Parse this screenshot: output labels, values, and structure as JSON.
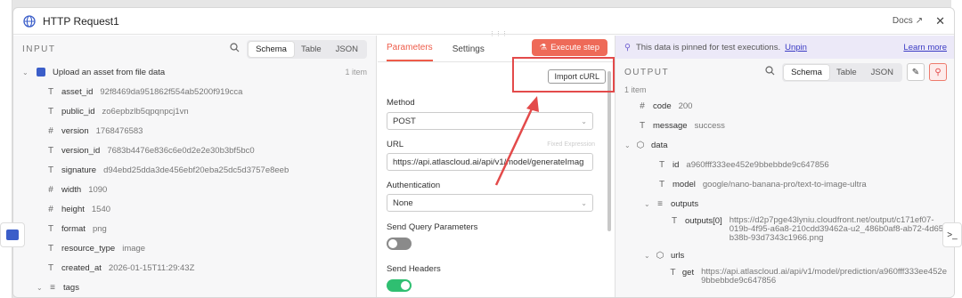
{
  "modal": {
    "title": "HTTP Request1",
    "docs_label": "Docs",
    "close_label": "✕"
  },
  "input": {
    "label": "INPUT",
    "view_tabs": [
      "Schema",
      "Table",
      "JSON"
    ],
    "root": {
      "label": "Upload an asset from file data",
      "count": "1 item"
    },
    "fields": [
      {
        "type": "T",
        "key": "asset_id",
        "value": "92f8469da951862f554ab5200f919cca"
      },
      {
        "type": "T",
        "key": "public_id",
        "value": "zo6epbzlb5qpqnpcj1vn"
      },
      {
        "type": "#",
        "key": "version",
        "value": "1768476583"
      },
      {
        "type": "T",
        "key": "version_id",
        "value": "7683b4476e836c6e0d2e2e30b3bf5bc0"
      },
      {
        "type": "T",
        "key": "signature",
        "value": "d94ebd25dda3de456ebf20eba25dc5d3757e8eeb"
      },
      {
        "type": "#",
        "key": "width",
        "value": "1090"
      },
      {
        "type": "#",
        "key": "height",
        "value": "1540"
      },
      {
        "type": "T",
        "key": "format",
        "value": "png"
      },
      {
        "type": "T",
        "key": "resource_type",
        "value": "image"
      },
      {
        "type": "T",
        "key": "created_at",
        "value": "2026-01-15T11:29:43Z"
      }
    ],
    "tags_label": "tags"
  },
  "middle": {
    "tabs": [
      "Parameters",
      "Settings"
    ],
    "execute_label": "Execute step",
    "import_label": "Import cURL",
    "method_label": "Method",
    "method_value": "POST",
    "url_label": "URL",
    "url_value": "https://api.atlascloud.ai/api/v1/model/generateImag",
    "fixed_expr": "Fixed  Expression",
    "auth_label": "Authentication",
    "auth_value": "None",
    "query_label": "Send Query Parameters",
    "headers_label": "Send Headers"
  },
  "output": {
    "pin_text": "This data is pinned for test executions.",
    "unpin_label": "Unpin",
    "learn_label": "Learn more",
    "label": "OUTPUT",
    "view_tabs": [
      "Schema",
      "Table",
      "JSON"
    ],
    "items": "1 item",
    "code": {
      "key": "code",
      "value": "200"
    },
    "message": {
      "key": "message",
      "value": "success"
    },
    "data_key": "data",
    "id": {
      "key": "id",
      "value": "a960fff333ee452e9bbebbde9c647856"
    },
    "model": {
      "key": "model",
      "value": "google/nano-banana-pro/text-to-image-ultra"
    },
    "outputs_key": "outputs",
    "outputs0": {
      "key": "outputs[0]",
      "value_line1": "https://d2p7pge43lyniu.cloudfront.net/output/c171ef07-",
      "value_line2": "019b-4f95-a6a8-210cdd39462a-u2_486b0af8-ab72-4d65-",
      "value_line3": "b38b-93d7343c1966.png"
    },
    "urls_key": "urls",
    "get": {
      "key": "get",
      "value_line1": "https://api.atlascloud.ai/api/v1/model/prediction/a960fff333ee452e",
      "value_line2": "9bbebbde9c647856"
    }
  },
  "colors": {
    "accent": "#ee5c4a",
    "link": "#3b3bc4",
    "toggle_on": "#2fbf71",
    "toggle_off": "#8a8a8a"
  }
}
